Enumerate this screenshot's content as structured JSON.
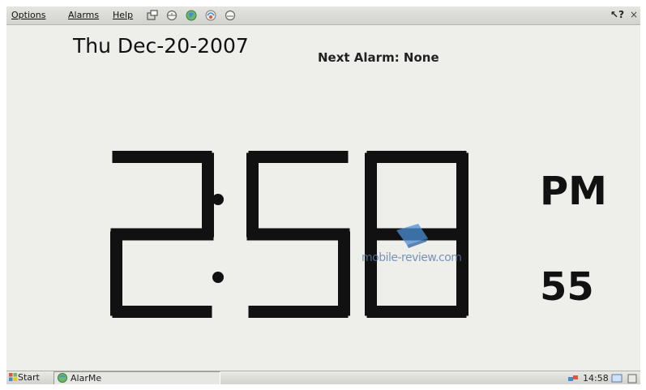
{
  "menu": {
    "options": "Options",
    "alarms": "Alarms",
    "help": "Help"
  },
  "toolbar_icons": [
    "window-icon",
    "alarm-clock-icon",
    "globe-icon",
    "world-clock-icon",
    "timer-icon"
  ],
  "help_button": "?",
  "close_button": "×",
  "date": "Thu Dec-20-2007",
  "next_alarm": "Next Alarm: None",
  "time": {
    "hours": "2",
    "minutes": "58",
    "ampm": "PM",
    "seconds": "55"
  },
  "watermark": "mobile-review.com",
  "taskbar": {
    "start_label": "Start",
    "task_label": "AlarMe",
    "tray_time": "14:58"
  },
  "colors": {
    "background": "#eeeeeb",
    "digit": "#111111",
    "bar": "#d8d8d4",
    "watermark": "#5a7da8"
  }
}
